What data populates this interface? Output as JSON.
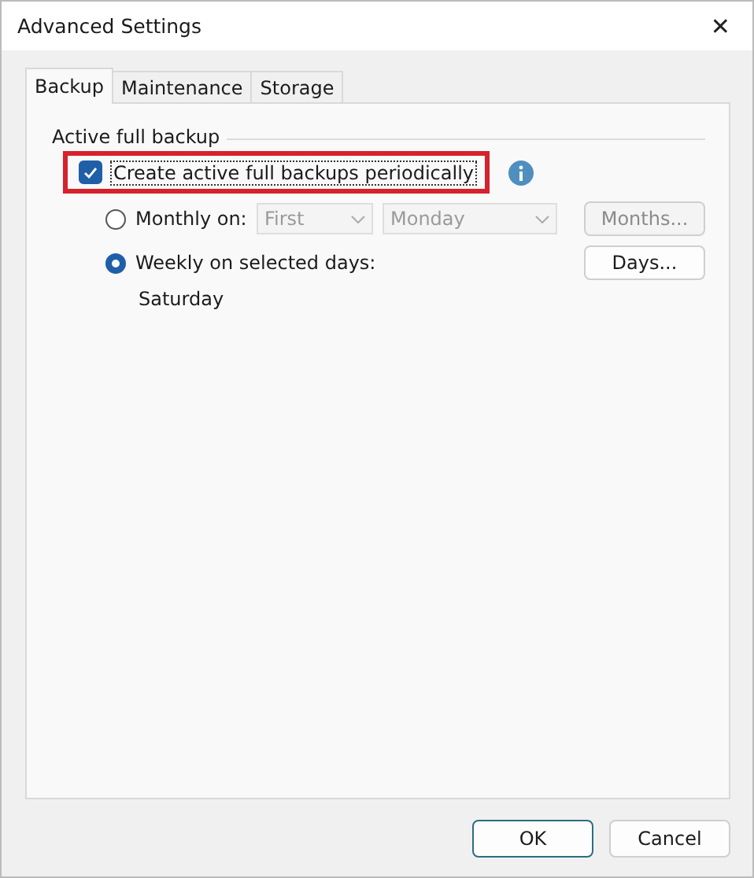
{
  "window": {
    "title": "Advanced Settings",
    "close": "✕"
  },
  "tabs": [
    {
      "label": "Backup",
      "selected": true
    },
    {
      "label": "Maintenance",
      "selected": false
    },
    {
      "label": "Storage",
      "selected": false
    }
  ],
  "group": {
    "label": "Active full backup",
    "checkbox": {
      "label": "Create active full backups periodically",
      "checked": true,
      "highlighted": true
    },
    "options": [
      {
        "label": "Monthly on:",
        "selected": false,
        "dropdowns": [
          {
            "value": "First",
            "disabled": true
          },
          {
            "value": "Monday",
            "disabled": true
          }
        ],
        "button": {
          "label": "Months...",
          "disabled": true
        }
      },
      {
        "label": "Weekly on selected days:",
        "selected": true,
        "detail": "Saturday",
        "button": {
          "label": "Days...",
          "disabled": false
        }
      }
    ]
  },
  "buttons": [
    {
      "label": "OK",
      "default": true
    },
    {
      "label": "Cancel",
      "default": false
    }
  ]
}
